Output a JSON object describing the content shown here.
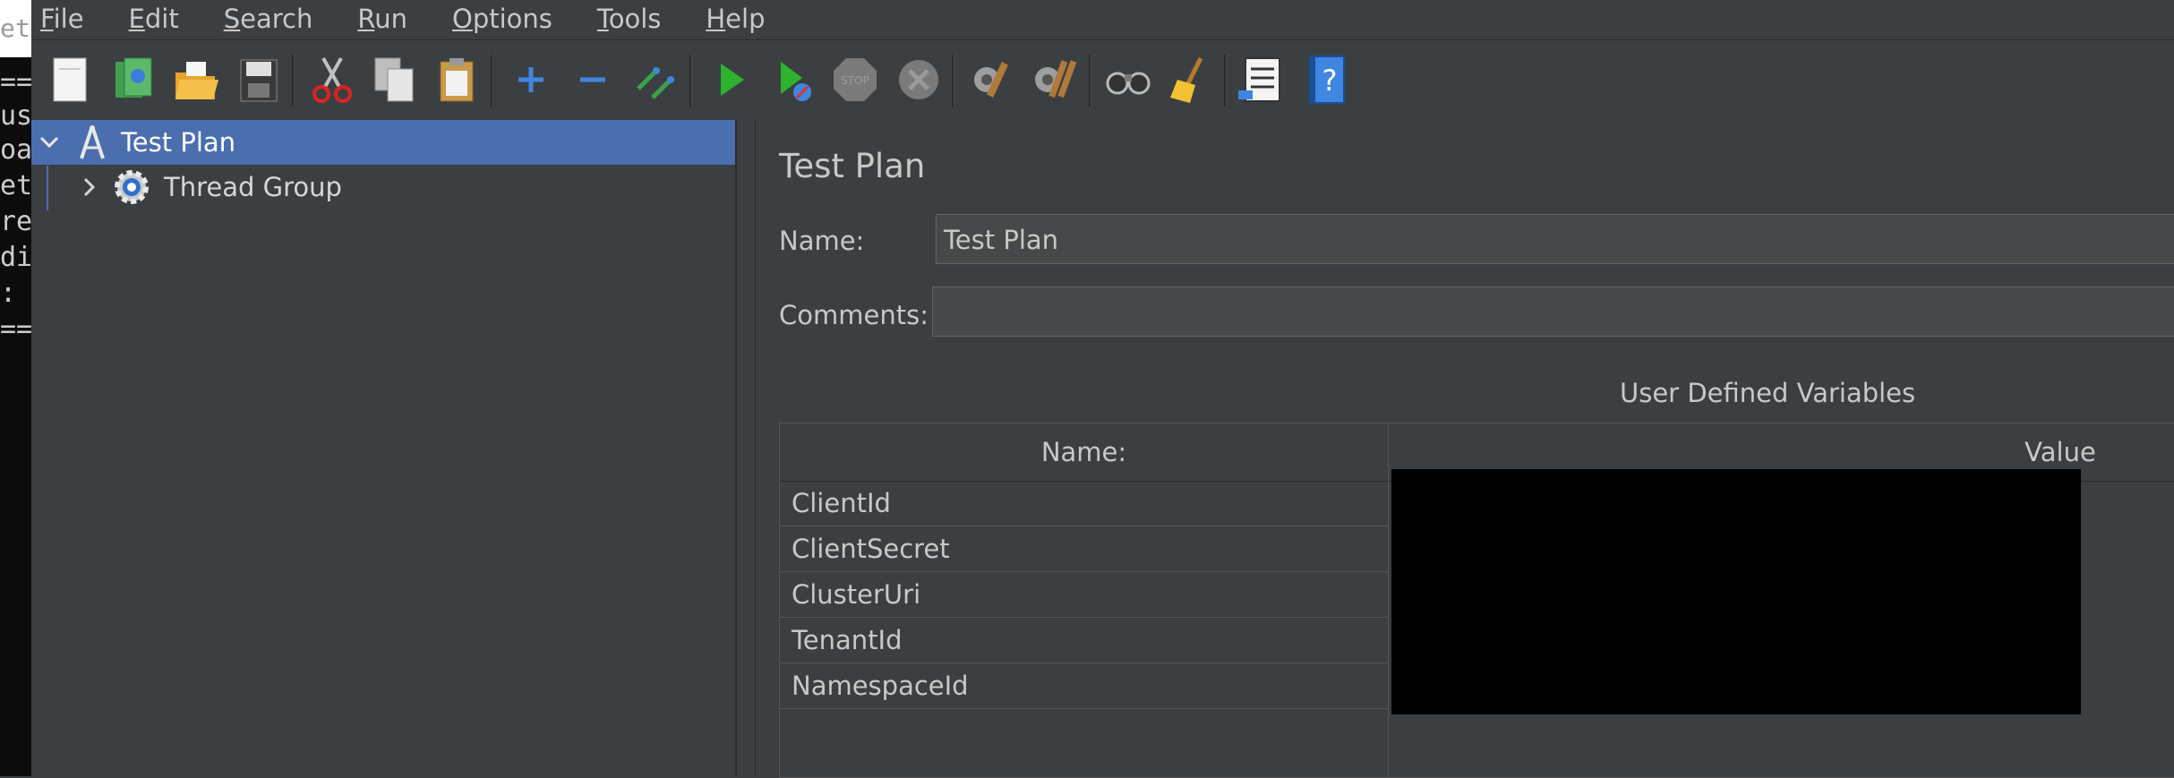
{
  "terminal": {
    "title_fragment": "ete",
    "lines": [
      "===",
      " us",
      "oad",
      "ete",
      "rea",
      "dit",
      " :",
      "==="
    ]
  },
  "menu": {
    "items": [
      {
        "mnemonic": "F",
        "rest": "ile"
      },
      {
        "mnemonic": "E",
        "rest": "dit"
      },
      {
        "mnemonic": "S",
        "rest": "earch"
      },
      {
        "mnemonic": "R",
        "rest": "un"
      },
      {
        "mnemonic": "O",
        "rest": "ptions"
      },
      {
        "mnemonic": "T",
        "rest": "ools"
      },
      {
        "mnemonic": "H",
        "rest": "elp"
      }
    ]
  },
  "toolbar": {
    "icons": [
      "new-icon",
      "templates-icon",
      "open-icon",
      "save-icon",
      "cut-icon",
      "copy-icon",
      "paste-icon",
      "expand-icon",
      "collapse-icon",
      "toggle-icon",
      "start-icon",
      "start-no-pauses-icon",
      "stop-icon",
      "shutdown-icon",
      "clear-icon",
      "clear-all-icon",
      "search-icon",
      "reset-search-icon",
      "function-helper-icon",
      "help-icon"
    ]
  },
  "tree": {
    "root_label": "Test Plan",
    "child_label": "Thread Group"
  },
  "main": {
    "title": "Test Plan",
    "name_label": "Name:",
    "name_value": "Test Plan",
    "comments_label": "Comments:",
    "comments_value": "",
    "udv_title": "User Defined Variables",
    "table_headers": {
      "name": "Name:",
      "value": "Value"
    },
    "variables": [
      "ClientId",
      "ClientSecret",
      "ClusterUri",
      "TenantId",
      "NamespaceId"
    ]
  },
  "colors": {
    "background": "#3c3f41",
    "selection": "#4b6eaf",
    "redaction": "#000000"
  }
}
